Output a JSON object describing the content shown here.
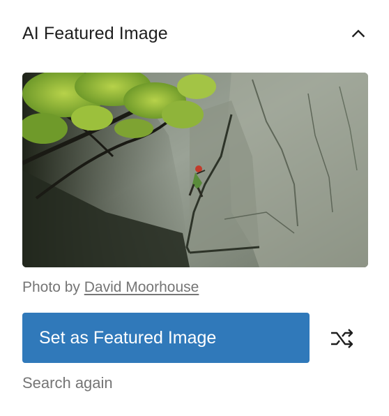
{
  "panel": {
    "title": "AI Featured Image",
    "toggle_icon": "chevron-up-icon"
  },
  "image": {
    "alt": "Climber on a granite rock face beneath an overhanging tree"
  },
  "credit": {
    "prefix": "Photo by ",
    "author": "David Moorhouse"
  },
  "actions": {
    "set_featured_label": "Set as Featured Image",
    "shuffle_icon": "shuffle-icon",
    "search_again_label": "Search again"
  },
  "colors": {
    "primary_button": "#3079ba",
    "text": "#1e1e1e",
    "muted_text": "#757575"
  }
}
